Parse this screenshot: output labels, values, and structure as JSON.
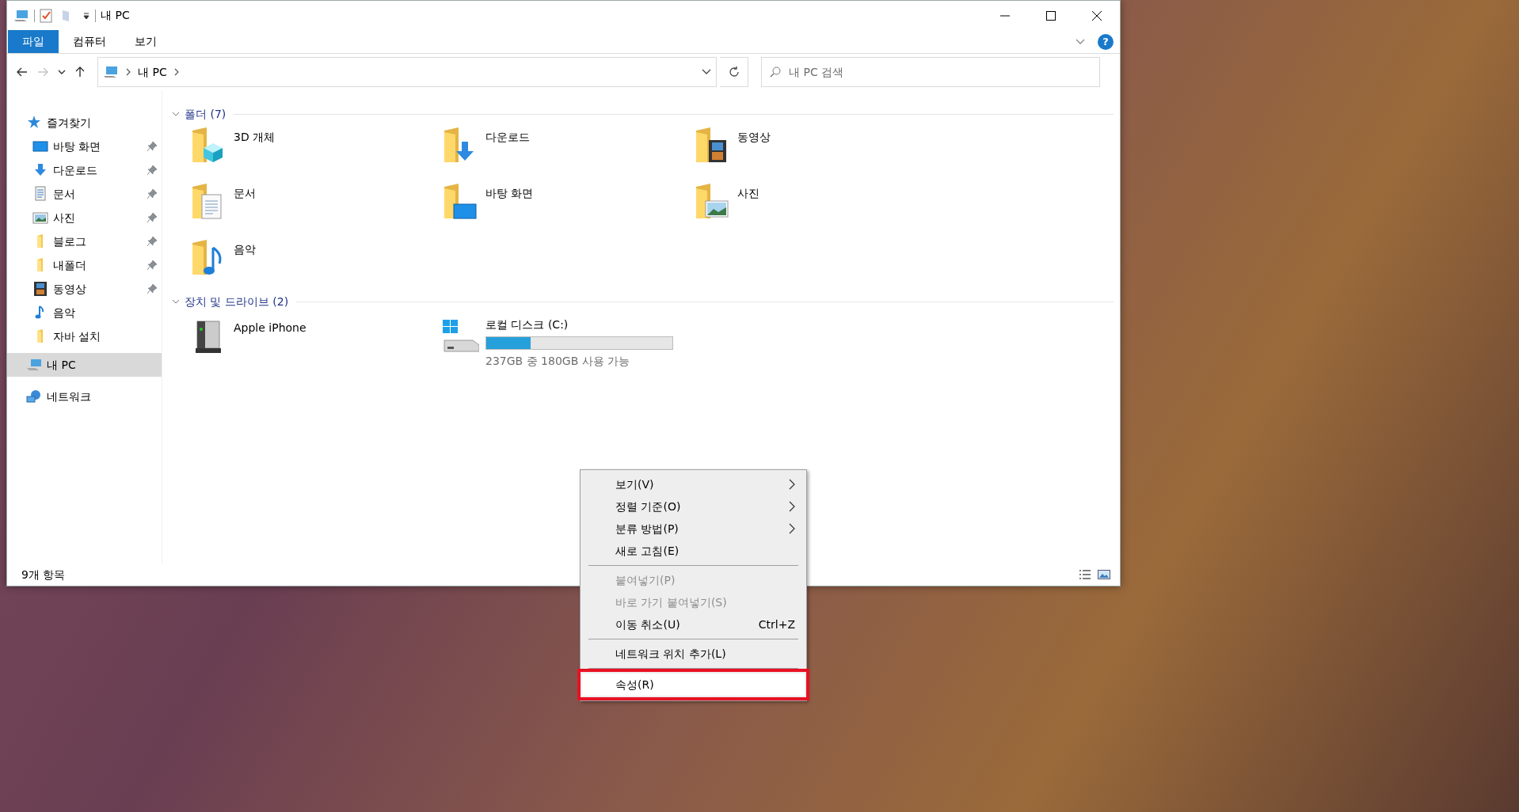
{
  "window": {
    "title": "내 PC"
  },
  "ribbon": {
    "tabs": [
      {
        "label": "파일",
        "selected": true
      },
      {
        "label": "컴퓨터",
        "selected": false
      },
      {
        "label": "보기",
        "selected": false
      }
    ],
    "help": "?"
  },
  "nav": {
    "back_disabled": false,
    "forward_disabled": true
  },
  "address_bar": {
    "path": [
      "내 PC"
    ]
  },
  "search": {
    "placeholder": "내 PC 검색"
  },
  "sidebar": {
    "items": [
      {
        "label": "즐겨찾기",
        "kind": "star",
        "selected": false,
        "children": [
          {
            "label": "바탕 화면",
            "kind": "desktop",
            "pinned": true,
            "selected": false
          },
          {
            "label": "다운로드",
            "kind": "download",
            "pinned": true,
            "selected": false
          },
          {
            "label": "문서",
            "kind": "docs",
            "pinned": true,
            "selected": false
          },
          {
            "label": "사진",
            "kind": "pictures",
            "pinned": true,
            "selected": false
          },
          {
            "label": "블로그",
            "kind": "folder",
            "pinned": true,
            "selected": false
          },
          {
            "label": "내폴더",
            "kind": "folder",
            "pinned": true,
            "selected": false
          },
          {
            "label": "동영상",
            "kind": "video",
            "pinned": true,
            "selected": false
          },
          {
            "label": "음악",
            "kind": "music",
            "pinned": false,
            "selected": false
          },
          {
            "label": "자바 설치",
            "kind": "folder",
            "pinned": false,
            "selected": false
          }
        ]
      },
      {
        "label": "내 PC",
        "kind": "pc",
        "selected": true
      },
      {
        "label": "네트워크",
        "kind": "network",
        "selected": false
      }
    ]
  },
  "groups": [
    {
      "title": "폴더 (7)",
      "expanded": true,
      "items": [
        {
          "label": "3D 개체",
          "kind": "objects3d"
        },
        {
          "label": "다운로드",
          "kind": "download"
        },
        {
          "label": "동영상",
          "kind": "video"
        },
        {
          "label": "문서",
          "kind": "docs"
        },
        {
          "label": "바탕 화면",
          "kind": "desktop"
        },
        {
          "label": "사진",
          "kind": "pictures"
        },
        {
          "label": "음악",
          "kind": "music"
        }
      ]
    },
    {
      "title": "장치 및 드라이브 (2)",
      "expanded": true,
      "items": [
        {
          "label": "Apple iPhone",
          "kind": "phone"
        },
        {
          "label": "로컬 디스크 (C:)",
          "kind": "drive",
          "level": 0.24,
          "detail": "237GB 중 180GB 사용 가능"
        }
      ]
    }
  ],
  "status_bar": {
    "text": "9개 항목"
  },
  "context_menu": {
    "items": [
      {
        "kind": "item",
        "label": "보기(V)",
        "submenu": true,
        "disabled": false,
        "selected": false
      },
      {
        "kind": "item",
        "label": "정렬 기준(O)",
        "submenu": true,
        "disabled": false,
        "selected": false
      },
      {
        "kind": "item",
        "label": "분류 방법(P)",
        "submenu": true,
        "disabled": false,
        "selected": false
      },
      {
        "kind": "item",
        "label": "새로 고침(E)",
        "submenu": false,
        "disabled": false,
        "selected": false
      },
      {
        "kind": "separator"
      },
      {
        "kind": "item",
        "label": "붙여넣기(P)",
        "submenu": false,
        "disabled": true,
        "selected": false
      },
      {
        "kind": "item",
        "label": "바로 가기 붙여넣기(S)",
        "submenu": false,
        "disabled": true,
        "selected": false
      },
      {
        "kind": "item",
        "label": "이동 취소(U)",
        "shortcut": "Ctrl+Z",
        "submenu": false,
        "disabled": false,
        "selected": false
      },
      {
        "kind": "separator"
      },
      {
        "kind": "item",
        "label": "네트워크 위치 추가(L)",
        "submenu": false,
        "disabled": false,
        "selected": false
      },
      {
        "kind": "separator"
      },
      {
        "kind": "item",
        "label": "속성(R)",
        "submenu": false,
        "disabled": false,
        "selected": true
      }
    ]
  }
}
